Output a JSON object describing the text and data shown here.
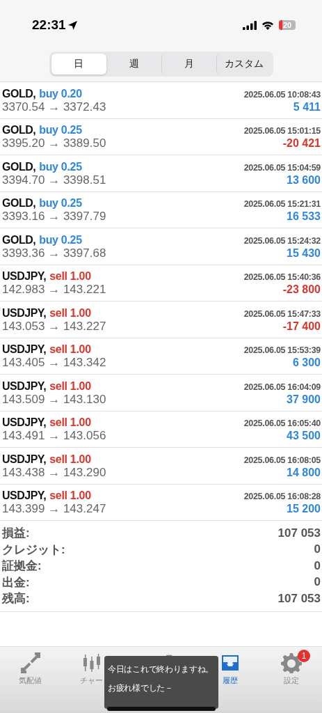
{
  "status_bar": {
    "time": "22:31",
    "battery": "20"
  },
  "periods": [
    {
      "label": "日",
      "selected": true
    },
    {
      "label": "週",
      "selected": false
    },
    {
      "label": "月",
      "selected": false
    },
    {
      "label": "カスタム",
      "selected": false
    }
  ],
  "trades": [
    {
      "symbol": "GOLD,",
      "side": "buy",
      "lots": "0.20",
      "time": "2025.06.05 10:08:43",
      "prices": "3370.54 → 3372.43",
      "profit": "5 411",
      "loss": false
    },
    {
      "symbol": "GOLD,",
      "side": "buy",
      "lots": "0.25",
      "time": "2025.06.05 15:01:15",
      "prices": "3395.20 → 3389.50",
      "profit": "-20 421",
      "loss": true
    },
    {
      "symbol": "GOLD,",
      "side": "buy",
      "lots": "0.25",
      "time": "2025.06.05 15:04:59",
      "prices": "3394.70 → 3398.51",
      "profit": "13 600",
      "loss": false
    },
    {
      "symbol": "GOLD,",
      "side": "buy",
      "lots": "0.25",
      "time": "2025.06.05 15:21:31",
      "prices": "3393.16 → 3397.79",
      "profit": "16 533",
      "loss": false
    },
    {
      "symbol": "GOLD,",
      "side": "buy",
      "lots": "0.25",
      "time": "2025.06.05 15:24:32",
      "prices": "3393.36 → 3397.68",
      "profit": "15 430",
      "loss": false
    },
    {
      "symbol": "USDJPY,",
      "side": "sell",
      "lots": "1.00",
      "time": "2025.06.05 15:40:36",
      "prices": "142.983 → 143.221",
      "profit": "-23 800",
      "loss": true
    },
    {
      "symbol": "USDJPY,",
      "side": "sell",
      "lots": "1.00",
      "time": "2025.06.05 15:47:33",
      "prices": "143.053 → 143.227",
      "profit": "-17 400",
      "loss": true
    },
    {
      "symbol": "USDJPY,",
      "side": "sell",
      "lots": "1.00",
      "time": "2025.06.05 15:53:39",
      "prices": "143.405 → 143.342",
      "profit": "6 300",
      "loss": false
    },
    {
      "symbol": "USDJPY,",
      "side": "sell",
      "lots": "1.00",
      "time": "2025.06.05 16:04:09",
      "prices": "143.509 → 143.130",
      "profit": "37 900",
      "loss": false
    },
    {
      "symbol": "USDJPY,",
      "side": "sell",
      "lots": "1.00",
      "time": "2025.06.05 16:05:40",
      "prices": "143.491 → 143.056",
      "profit": "43 500",
      "loss": false
    },
    {
      "symbol": "USDJPY,",
      "side": "sell",
      "lots": "1.00",
      "time": "2025.06.05 16:08:05",
      "prices": "143.438 → 143.290",
      "profit": "14 800",
      "loss": false
    },
    {
      "symbol": "USDJPY,",
      "side": "sell",
      "lots": "1.00",
      "time": "2025.06.05 16:08:28",
      "prices": "143.399 → 143.247",
      "profit": "15 200",
      "loss": false
    }
  ],
  "summary": [
    {
      "label": "損益:",
      "value": "107 053"
    },
    {
      "label": "クレジット:",
      "value": "0"
    },
    {
      "label": "証拠金:",
      "value": "0"
    },
    {
      "label": "出金:",
      "value": "0"
    },
    {
      "label": "残高:",
      "value": "107 053"
    }
  ],
  "tab_bar": [
    {
      "kind": "quotes",
      "label": "気配値",
      "selected": false
    },
    {
      "kind": "chart",
      "label": "チャー",
      "selected": false
    },
    {
      "kind": "trade",
      "selected": false
    },
    {
      "kind": "history",
      "label": "履歴",
      "selected": true
    },
    {
      "kind": "settings",
      "label": "設定",
      "selected": false,
      "badge": "1"
    }
  ],
  "caption": [
    "今日はこれで終わりますね。",
    "お疲れ様でした－"
  ]
}
